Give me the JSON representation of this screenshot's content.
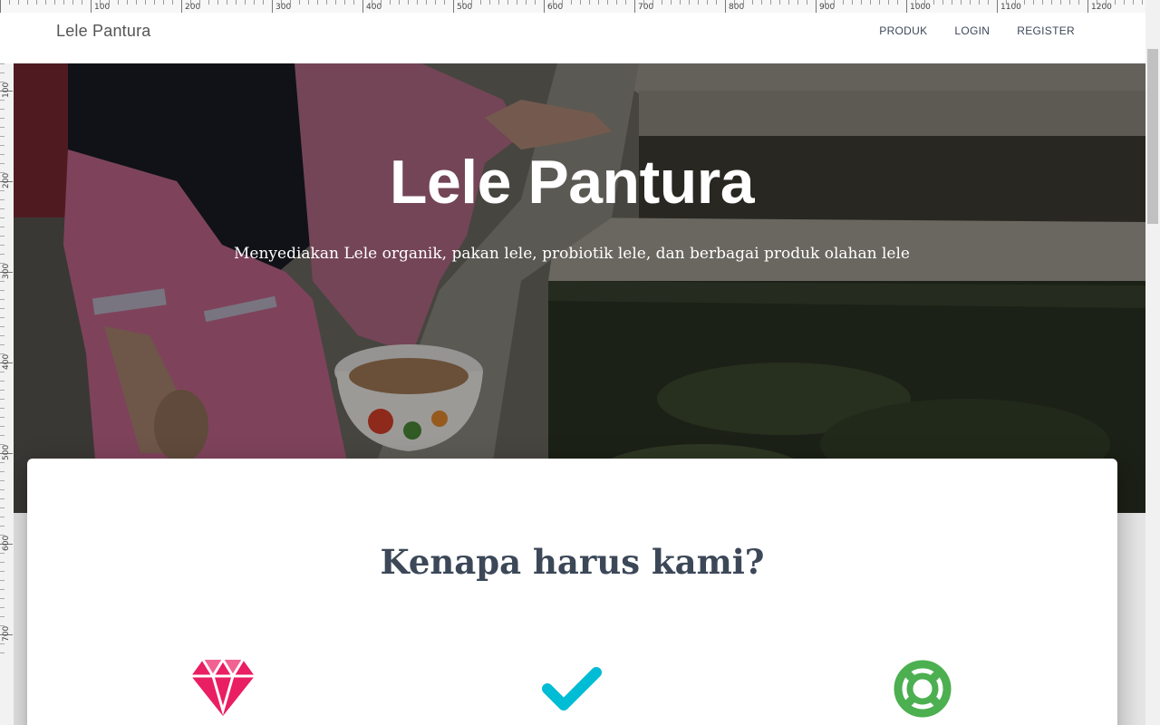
{
  "navbar": {
    "brand": "Lele Pantura",
    "links": [
      "PRODUK",
      "LOGIN",
      "REGISTER"
    ]
  },
  "ruler": {
    "top_labels": [
      "100",
      "200",
      "300",
      "400",
      "500",
      "600",
      "700",
      "800",
      "900",
      "1000",
      "1100",
      "1200"
    ],
    "left_labels": [
      "100",
      "200",
      "300",
      "400",
      "500",
      "600",
      "700"
    ]
  },
  "hero": {
    "title": "Lele Pantura",
    "subtitle": "Menyediakan Lele organik, pakan lele, probiotik lele, dan berbagai produk olahan lele"
  },
  "section": {
    "title": "Kenapa harus kami?"
  },
  "features": [
    {
      "icon": "diamond-icon",
      "color": "#e91e63"
    },
    {
      "icon": "check-icon",
      "color": "#00bcd4"
    },
    {
      "icon": "lifebuoy-icon",
      "color": "#4caf50"
    }
  ]
}
